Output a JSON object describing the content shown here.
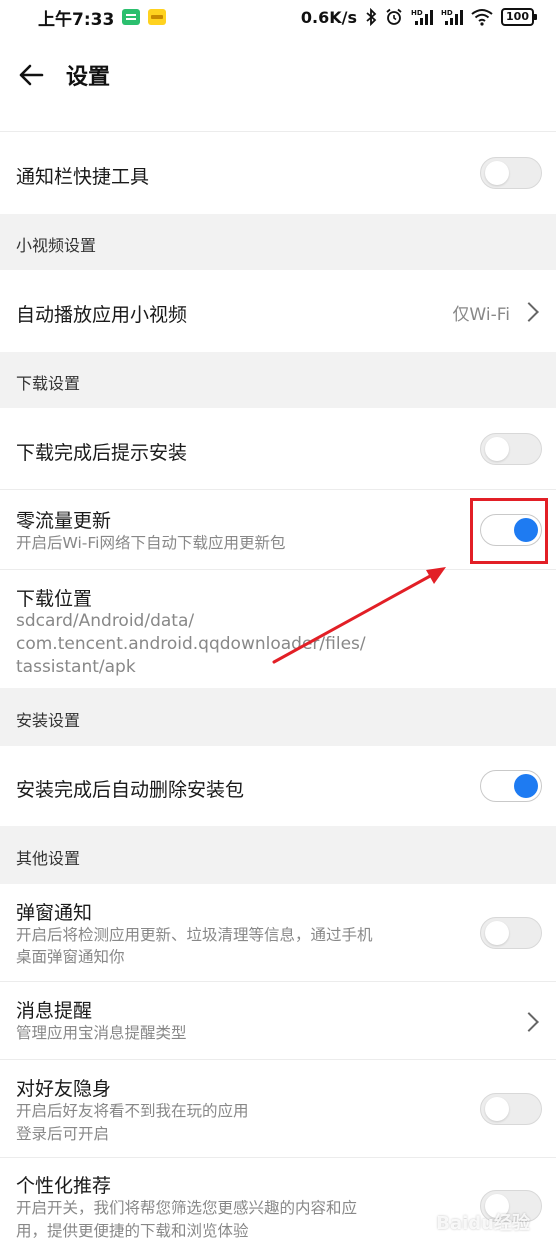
{
  "status_bar": {
    "time": "上午7:33",
    "net_speed": "0.6K/s",
    "battery": "100"
  },
  "header": {
    "title": "设置"
  },
  "rows": {
    "notification_tools": {
      "title": "通知栏快捷工具",
      "toggle_on": false
    },
    "autoplay_video": {
      "title": "自动播放应用小视频",
      "value": "仅Wi-Fi"
    },
    "install_prompt": {
      "title": "下载完成后提示安装",
      "toggle_on": false
    },
    "zero_traffic": {
      "title": "零流量更新",
      "subtitle": "开启后Wi-Fi网络下自动下载应用更新包",
      "toggle_on": true
    },
    "download_location": {
      "title": "下载位置",
      "path_line1": "sdcard/Android/data/",
      "path_line2": "com.tencent.android.qqdownloader/files/",
      "path_line3": "tassistant/apk"
    },
    "auto_delete": {
      "title": "安装完成后自动删除安装包",
      "toggle_on": true
    },
    "popup_notify": {
      "title": "弹窗通知",
      "subtitle_line1": "开启后将检测应用更新、垃圾清理等信息，通过手机",
      "subtitle_line2": "桌面弹窗通知你",
      "toggle_on": false
    },
    "message_remind": {
      "title": "消息提醒",
      "subtitle": "管理应用宝消息提醒类型"
    },
    "invisible_friends": {
      "title": "对好友隐身",
      "subtitle_line1": "开启后好友将看不到我在玩的应用",
      "subtitle_line2": "登录后可开启",
      "toggle_on": false
    },
    "personalized": {
      "title": "个性化推荐",
      "subtitle_line1": "开启开关，我们将帮您筛选您更感兴趣的内容和应",
      "subtitle_line2": "用，提供更便捷的下载和浏览体验",
      "toggle_on": false
    }
  },
  "sections": {
    "video": "小视频设置",
    "download": "下载设置",
    "install": "安装设置",
    "other": "其他设置"
  },
  "watermark": "Baidu经验",
  "colors": {
    "accent_blue": "#1e7bf2",
    "annotation_red": "#e21f26",
    "section_bg": "#f2f2f2"
  }
}
